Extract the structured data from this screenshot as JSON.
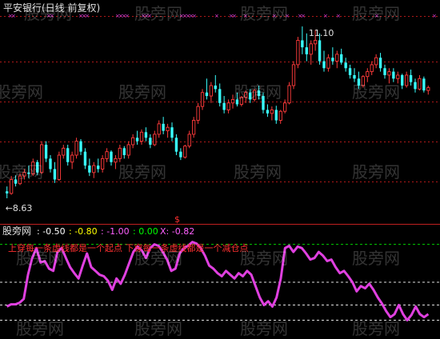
{
  "main_panel": {
    "title": "平安银行(日线 前复权)",
    "high_label": "11.10",
    "low_label": "←8.63",
    "colors": {
      "up": "#ff3b3b",
      "down": "#39ffff",
      "grid": "#b01818",
      "title": "#e0e0e0",
      "marker": "#e040e0"
    }
  },
  "divider_mark": {
    "text": "$",
    "color": "#ff3030"
  },
  "indicator_panel": {
    "name": "股旁网",
    "values": [
      {
        "text": ": -0.50",
        "color": "#ffffff"
      },
      {
        "text": ": -0.80",
        "color": "#ffff00"
      },
      {
        "text": ": -1.00",
        "color": "#ff60ff"
      },
      {
        "text": ": 0.00",
        "color": "#00ff00"
      },
      {
        "text": "X: -0.82",
        "color": "#ff60ff"
      }
    ],
    "annotation": "上穿每一条虚线都是一个起点  下穿每一条虚线都是一个减仓点",
    "annotation_color": "#ff3030",
    "line_color": "#e040e0"
  },
  "watermark": "股旁网",
  "chart_data": [
    {
      "type": "candlestick",
      "title": "平安银行(日线 前复权)",
      "ylim": [
        8.4,
        11.25
      ],
      "annotations": [
        {
          "text": "11.10",
          "value": 11.1,
          "kind": "high"
        },
        {
          "text": "←8.63",
          "value": 8.63,
          "kind": "low"
        }
      ],
      "grid": true,
      "ohlc": [
        [
          8.73,
          8.8,
          8.63,
          8.7
        ],
        [
          8.7,
          8.95,
          8.68,
          8.9
        ],
        [
          8.9,
          8.96,
          8.8,
          8.84
        ],
        [
          8.84,
          8.99,
          8.82,
          8.95
        ],
        [
          8.95,
          9.05,
          8.9,
          9.0
        ],
        [
          9.0,
          9.1,
          8.92,
          8.98
        ],
        [
          8.98,
          9.2,
          8.95,
          9.15
        ],
        [
          9.15,
          9.18,
          8.96,
          9.0
        ],
        [
          9.0,
          9.45,
          8.98,
          9.4
        ],
        [
          9.4,
          9.45,
          9.15,
          9.2
        ],
        [
          9.2,
          9.25,
          9.0,
          9.05
        ],
        [
          9.05,
          9.15,
          8.85,
          8.9
        ],
        [
          8.9,
          9.3,
          8.88,
          9.25
        ],
        [
          9.25,
          9.4,
          9.2,
          9.35
        ],
        [
          9.35,
          9.4,
          9.1,
          9.15
        ],
        [
          9.15,
          9.3,
          9.05,
          9.25
        ],
        [
          9.25,
          9.5,
          9.2,
          9.45
        ],
        [
          9.45,
          9.48,
          9.25,
          9.3
        ],
        [
          9.3,
          9.35,
          9.05,
          9.1
        ],
        [
          9.1,
          9.2,
          8.95,
          9.0
        ],
        [
          9.0,
          9.15,
          8.92,
          9.1
        ],
        [
          9.1,
          9.2,
          9.0,
          9.05
        ],
        [
          9.05,
          9.25,
          9.0,
          9.2
        ],
        [
          9.2,
          9.35,
          9.15,
          9.3
        ],
        [
          9.3,
          9.32,
          9.1,
          9.15
        ],
        [
          9.15,
          9.25,
          9.05,
          9.2
        ],
        [
          9.2,
          9.4,
          9.15,
          9.35
        ],
        [
          9.35,
          9.38,
          9.2,
          9.25
        ],
        [
          9.25,
          9.45,
          9.2,
          9.4
        ],
        [
          9.4,
          9.55,
          9.35,
          9.5
        ],
        [
          9.5,
          9.6,
          9.4,
          9.45
        ],
        [
          9.45,
          9.62,
          9.4,
          9.58
        ],
        [
          9.58,
          9.65,
          9.45,
          9.5
        ],
        [
          9.5,
          9.55,
          9.35,
          9.4
        ],
        [
          9.4,
          9.6,
          9.38,
          9.55
        ],
        [
          9.55,
          9.75,
          9.5,
          9.7
        ],
        [
          9.7,
          9.8,
          9.55,
          9.6
        ],
        [
          9.6,
          9.7,
          9.5,
          9.65
        ],
        [
          9.65,
          9.72,
          9.45,
          9.5
        ],
        [
          9.5,
          9.55,
          9.25,
          9.3
        ],
        [
          9.3,
          9.35,
          9.18,
          9.22
        ],
        [
          9.22,
          9.4,
          9.2,
          9.38
        ],
        [
          9.38,
          9.6,
          9.35,
          9.55
        ],
        [
          9.55,
          9.8,
          9.5,
          9.75
        ],
        [
          9.75,
          10.0,
          9.7,
          9.95
        ],
        [
          9.95,
          10.2,
          9.9,
          10.15
        ],
        [
          10.15,
          10.35,
          10.05,
          10.1
        ],
        [
          10.1,
          10.3,
          10.0,
          10.25
        ],
        [
          10.25,
          10.4,
          10.15,
          10.2
        ],
        [
          10.2,
          10.28,
          9.95,
          10.0
        ],
        [
          10.0,
          10.1,
          9.85,
          9.9
        ],
        [
          9.9,
          10.05,
          9.85,
          10.0
        ],
        [
          10.0,
          10.12,
          9.92,
          10.05
        ],
        [
          10.05,
          10.15,
          9.95,
          9.98
        ],
        [
          9.98,
          10.1,
          9.95,
          10.08
        ],
        [
          10.08,
          10.18,
          10.0,
          10.15
        ],
        [
          10.15,
          10.2,
          10.0,
          10.05
        ],
        [
          10.05,
          10.2,
          10.02,
          10.18
        ],
        [
          10.18,
          10.25,
          10.05,
          10.1
        ],
        [
          10.1,
          10.15,
          9.85,
          9.9
        ],
        [
          9.9,
          9.98,
          9.8,
          9.85
        ],
        [
          9.85,
          9.95,
          9.75,
          9.9
        ],
        [
          9.9,
          9.96,
          9.7,
          9.75
        ],
        [
          9.75,
          9.9,
          9.7,
          9.88
        ],
        [
          9.88,
          10.05,
          9.85,
          10.0
        ],
        [
          10.0,
          10.3,
          9.98,
          10.25
        ],
        [
          10.25,
          10.6,
          10.2,
          10.55
        ],
        [
          10.55,
          10.95,
          10.5,
          10.9
        ],
        [
          10.9,
          11.1,
          10.7,
          10.8
        ],
        [
          10.8,
          11.0,
          10.6,
          10.7
        ],
        [
          10.7,
          10.9,
          10.55,
          10.85
        ],
        [
          10.85,
          11.05,
          10.75,
          10.9
        ],
        [
          10.9,
          11.0,
          10.55,
          10.6
        ],
        [
          10.6,
          10.75,
          10.45,
          10.5
        ],
        [
          10.5,
          10.7,
          10.45,
          10.65
        ],
        [
          10.65,
          10.8,
          10.55,
          10.6
        ],
        [
          10.6,
          10.75,
          10.5,
          10.7
        ],
        [
          10.7,
          10.78,
          10.55,
          10.58
        ],
        [
          10.58,
          10.65,
          10.45,
          10.5
        ],
        [
          10.5,
          10.55,
          10.35,
          10.4
        ],
        [
          10.4,
          10.5,
          10.3,
          10.35
        ],
        [
          10.35,
          10.45,
          10.2,
          10.25
        ],
        [
          10.25,
          10.4,
          10.22,
          10.38
        ],
        [
          10.38,
          10.5,
          10.3,
          10.45
        ],
        [
          10.45,
          10.6,
          10.4,
          10.55
        ],
        [
          10.55,
          10.7,
          10.5,
          10.65
        ],
        [
          10.65,
          10.72,
          10.45,
          10.5
        ],
        [
          10.5,
          10.55,
          10.35,
          10.4
        ],
        [
          10.4,
          10.5,
          10.28,
          10.45
        ],
        [
          10.45,
          10.5,
          10.3,
          10.35
        ],
        [
          10.35,
          10.45,
          10.28,
          10.4
        ],
        [
          10.4,
          10.42,
          10.2,
          10.25
        ],
        [
          10.25,
          10.45,
          10.22,
          10.4
        ],
        [
          10.4,
          10.48,
          10.25,
          10.3
        ],
        [
          10.3,
          10.35,
          10.15,
          10.2
        ],
        [
          10.2,
          10.4,
          10.18,
          10.35
        ],
        [
          10.35,
          10.38,
          10.15,
          10.18
        ],
        [
          10.18,
          10.25,
          10.12,
          10.22
        ]
      ]
    },
    {
      "type": "line",
      "title": "股旁网",
      "ylim": [
        -1.1,
        0.08
      ],
      "reference_lines": [
        0.0,
        -0.5,
        -0.8,
        -1.0
      ],
      "series": [
        {
          "values": [
            -0.82,
            -0.79,
            -0.79,
            -0.77,
            -0.72,
            -0.4,
            -0.18,
            -0.05,
            -0.24,
            -0.22,
            -0.32,
            -0.35,
            -0.1,
            -0.05,
            -0.18,
            -0.3,
            -0.38,
            -0.45,
            -0.28,
            -0.12,
            -0.3,
            -0.35,
            -0.4,
            -0.42,
            -0.48,
            -0.6,
            -0.45,
            -0.52,
            -0.4,
            -0.25,
            -0.1,
            -0.03,
            -0.08,
            -0.18,
            -0.05,
            0.0,
            -0.02,
            -0.1,
            -0.2,
            -0.35,
            -0.32,
            -0.12,
            -0.05,
            -0.02,
            0.03,
            0.01,
            -0.05,
            -0.15,
            -0.28,
            -0.32,
            -0.38,
            -0.42,
            -0.35,
            -0.4,
            -0.45,
            -0.38,
            -0.42,
            -0.35,
            -0.4,
            -0.55,
            -0.7,
            -0.8,
            -0.75,
            -0.82,
            -0.7,
            -0.45,
            -0.05,
            -0.02,
            -0.1,
            -0.03,
            -0.05,
            -0.12,
            -0.2,
            -0.18,
            -0.1,
            -0.15,
            -0.22,
            -0.2,
            -0.3,
            -0.38,
            -0.35,
            -0.42,
            -0.5,
            -0.62,
            -0.55,
            -0.58,
            -0.52,
            -0.6,
            -0.7,
            -0.78,
            -0.88,
            -0.96,
            -0.92,
            -0.8,
            -0.92,
            -1.0,
            -0.93,
            -0.82,
            -0.92,
            -0.96,
            -0.92
          ]
        }
      ]
    }
  ]
}
